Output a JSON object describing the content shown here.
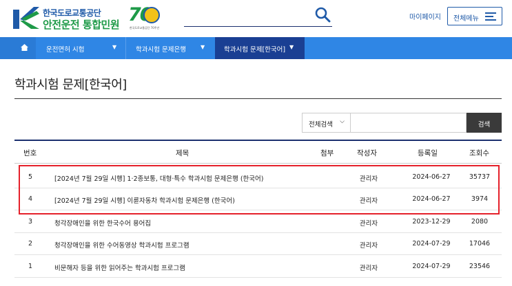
{
  "header": {
    "org_name": "한국도로교통공단",
    "service_name": "안전운전 통합민원",
    "anniversary_number": "70",
    "anniversary_sub": "한국도로교통공단 70주년",
    "mypage_label": "마이페이지",
    "allmenu_label": "전체메뉴"
  },
  "nav": {
    "items": [
      {
        "label": "운전면허 시험",
        "active": false
      },
      {
        "label": "학과시험 문제은행",
        "active": false
      },
      {
        "label": "학과시험 문제[한국어]",
        "active": true
      }
    ]
  },
  "page": {
    "title": "학과시험 문제[한국어]"
  },
  "search": {
    "scope_label": "전체검색",
    "input_value": "",
    "button_label": "검색"
  },
  "table": {
    "headers": {
      "no": "번호",
      "title": "제목",
      "attach": "첨부",
      "author": "작성자",
      "date": "등록일",
      "views": "조회수"
    },
    "rows": [
      {
        "no": "5",
        "title": "[2024년 7월 29일 시행] 1·2종보통, 대형·특수 학과시험 문제은행 (한국어)",
        "author": "관리자",
        "date": "2024-06-27",
        "views": "35737"
      },
      {
        "no": "4",
        "title": "[2024년 7월 29일 시행] 이륜자동차 학과시험 문제은행 (한국어)",
        "author": "관리자",
        "date": "2024-06-27",
        "views": "3974"
      },
      {
        "no": "3",
        "title": "청각장애인을 위한 한국수어 용어집",
        "author": "관리자",
        "date": "2023-12-29",
        "views": "2080"
      },
      {
        "no": "2",
        "title": "청각장애인을 위한 수어동영상 학과시험 프로그램",
        "author": "관리자",
        "date": "2024-07-29",
        "views": "17046"
      },
      {
        "no": "1",
        "title": "비문해자 등을 위한 읽어주는 학과시험 프로그램",
        "author": "관리자",
        "date": "2024-07-29",
        "views": "23546"
      }
    ]
  },
  "colors": {
    "brand_blue": "#1f5aa8",
    "brand_green": "#1e9a48",
    "nav_blue": "#2f86e5",
    "nav_active": "#1a3f93",
    "highlight_red": "#e5202a"
  }
}
